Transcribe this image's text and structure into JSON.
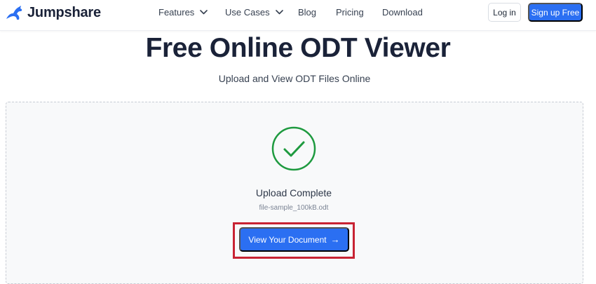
{
  "brand": {
    "name": "Jumpshare",
    "accent_color": "#2b6ff2"
  },
  "nav": {
    "items": [
      {
        "label": "Features",
        "has_dropdown": true
      },
      {
        "label": "Use Cases",
        "has_dropdown": true
      },
      {
        "label": "Blog",
        "has_dropdown": false
      },
      {
        "label": "Pricing",
        "has_dropdown": false
      },
      {
        "label": "Download",
        "has_dropdown": false
      }
    ],
    "login_label": "Log in",
    "signup_label": "Sign up Free"
  },
  "hero": {
    "title": "Free Online ODT Viewer",
    "subtitle": "Upload and View ODT Files Online"
  },
  "upload": {
    "status_icon": "check-circle-icon",
    "status_color": "#1e9a3f",
    "status_text": "Upload Complete",
    "file_name": "file-sample_100kB.odt",
    "view_button_label": "View Your Document",
    "view_button_icon": "arrow-right-icon",
    "highlight_color": "#c82333"
  }
}
